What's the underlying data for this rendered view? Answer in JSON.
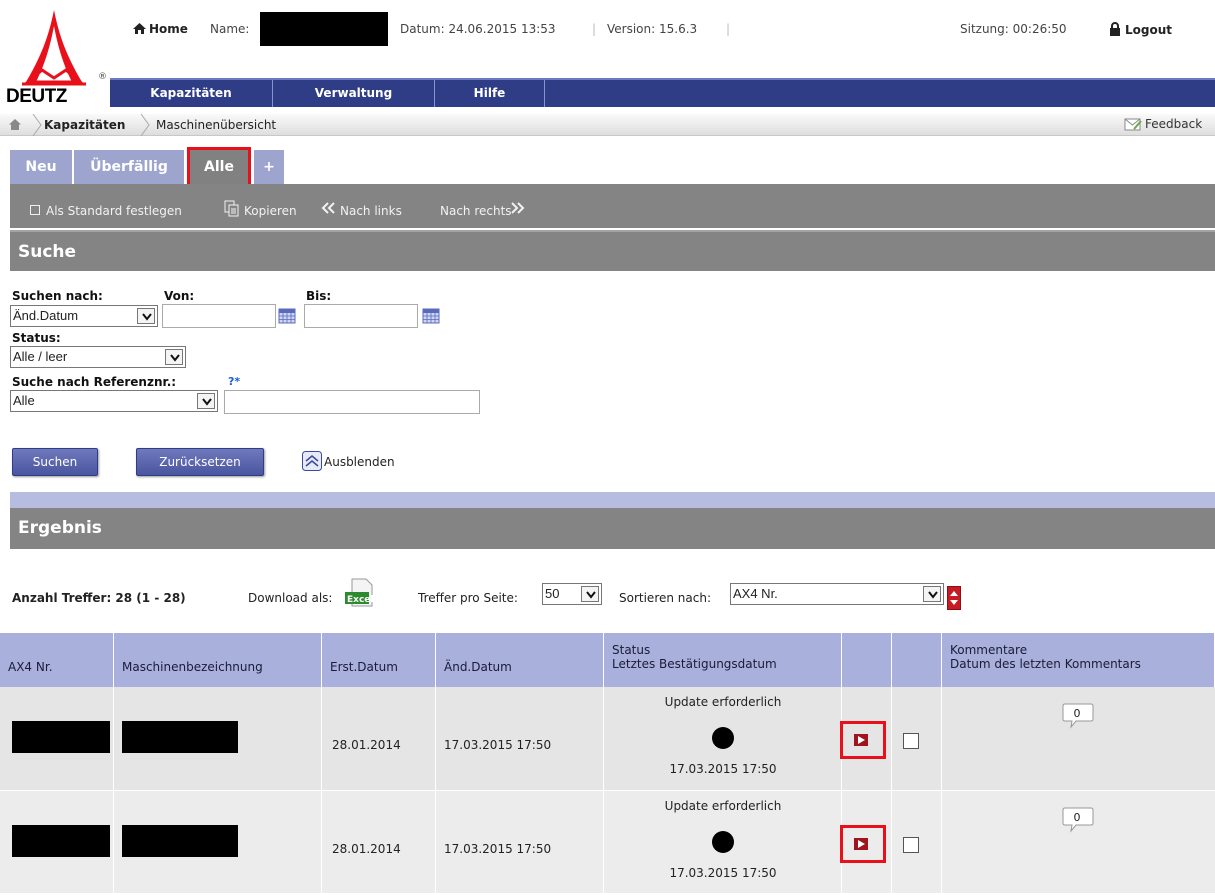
{
  "brand": {
    "logo_text": "DEUTZ",
    "registered": "®"
  },
  "header": {
    "home": "Home",
    "name_label": "Name:",
    "datum": "Datum: 24.06.2015 13:53",
    "separator": "|",
    "version": "Version: 15.6.3",
    "sitzung": "Sitzung:  00:26:50",
    "logout": "Logout"
  },
  "nav": {
    "items": [
      "Kapazitäten",
      "Verwaltung",
      "Hilfe"
    ]
  },
  "breadcrumb": {
    "section": "Kapazitäten",
    "page": "Maschinenübersicht",
    "feedback": "Feedback"
  },
  "tabs": [
    "Neu",
    "Überfällig",
    "Alle",
    "+"
  ],
  "toolbar": {
    "standard": "Als Standard festlegen",
    "copy": "Kopieren",
    "left": "Nach links",
    "right": "Nach rechts"
  },
  "search": {
    "heading": "Suche",
    "search_by_label": "Suchen nach:",
    "search_by_value": "Änd.Datum",
    "from_label": "Von:",
    "to_label": "Bis:",
    "status_label": "Status:",
    "status_value": "Alle / leer",
    "ref_label": "Suche nach Referenznr.:",
    "ref_help": "?*",
    "ref_value": "Alle",
    "submit": "Suchen",
    "reset": "Zurücksetzen",
    "hide": "Ausblenden"
  },
  "results": {
    "heading": "Ergebnis",
    "count": "Anzahl Treffer: 28 (1 - 28)",
    "download_label": "Download als:",
    "per_page_label": "Treffer pro Seite:",
    "per_page_value": "50",
    "sort_label": "Sortieren nach:",
    "sort_value": "AX4 Nr."
  },
  "table": {
    "columns": {
      "ax4": "AX4 Nr.",
      "machine": "Maschinenbezeichnung",
      "created": "Erst.Datum",
      "changed": "Änd.Datum",
      "status_1": "Status",
      "status_2": "Letztes Bestätigungsdatum",
      "comments_1": "Kommentare",
      "comments_2": "Datum des letzten Kommentars"
    },
    "rows": [
      {
        "created": "28.01.2014",
        "changed": "17.03.2015 17:50",
        "status": "Update erforderlich",
        "confirmed": "17.03.2015 17:50",
        "comments": "0"
      },
      {
        "created": "28.01.2014",
        "changed": "17.03.2015 17:50",
        "status": "Update erforderlich",
        "confirmed": "17.03.2015 17:50",
        "comments": "0"
      }
    ]
  }
}
